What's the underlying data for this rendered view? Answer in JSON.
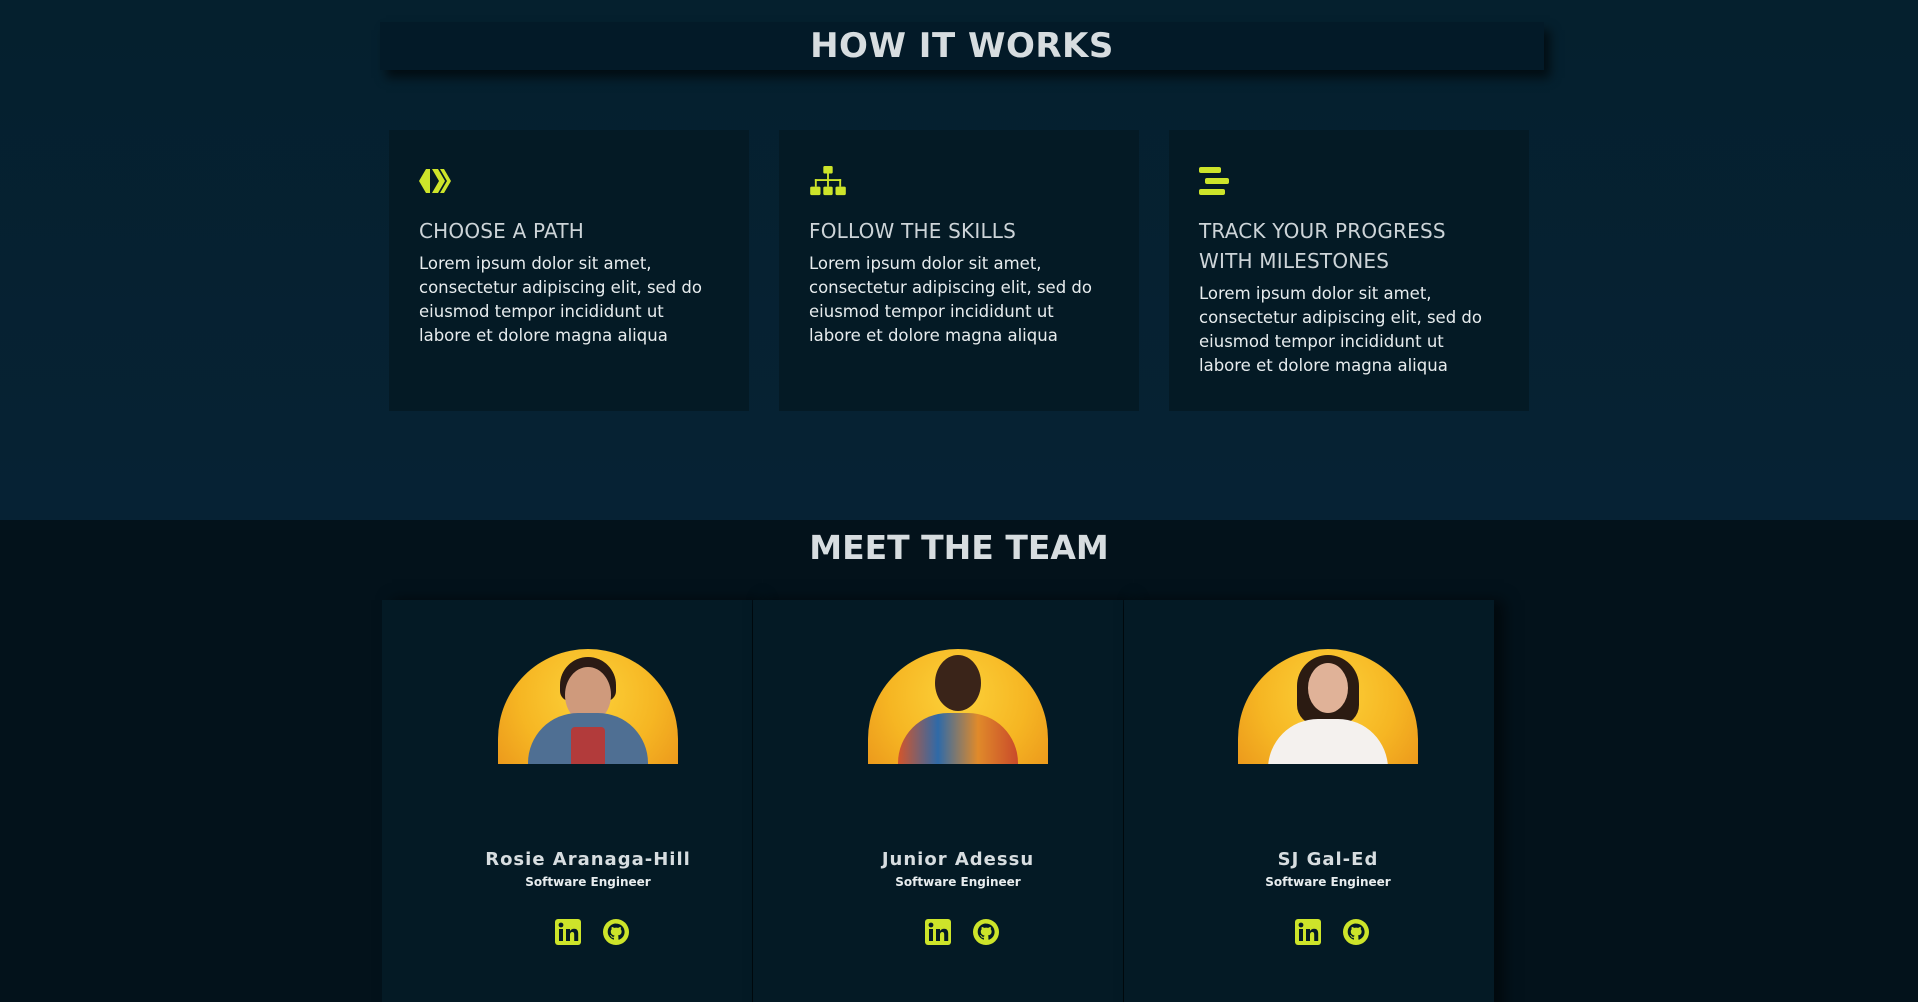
{
  "how_it_works": {
    "title": "HOW IT WORKS",
    "cards": [
      {
        "icon": "hive-icon",
        "title": "CHOOSE A PATH",
        "text": "Lorem ipsum dolor sit amet, consectetur adipiscing elit, sed do eiusmod tempor incididunt ut labore et dolore magna aliqua"
      },
      {
        "icon": "sitemap-icon",
        "title": "FOLLOW THE SKILLS",
        "text": "Lorem ipsum dolor sit amet, consectetur adipiscing elit, sed do eiusmod tempor incididunt ut labore et dolore magna aliqua"
      },
      {
        "icon": "stream-icon",
        "title": "TRACK YOUR PROGRESS WITH MILESTONES",
        "text": "Lorem ipsum dolor sit amet, consectetur adipiscing elit, sed do eiusmod tempor incididunt ut labore et dolore magna aliqua"
      }
    ]
  },
  "team": {
    "title": "MEET THE TEAM",
    "members": [
      {
        "name": "Rosie Aranaga-Hill",
        "role": "Software Engineer"
      },
      {
        "name": "Junior Adessu",
        "role": "Software Engineer"
      },
      {
        "name": "SJ Gal-Ed",
        "role": "Software Engineer"
      }
    ]
  },
  "colors": {
    "accent": "#cde42a",
    "background": "#062234",
    "card": "#041a25"
  }
}
